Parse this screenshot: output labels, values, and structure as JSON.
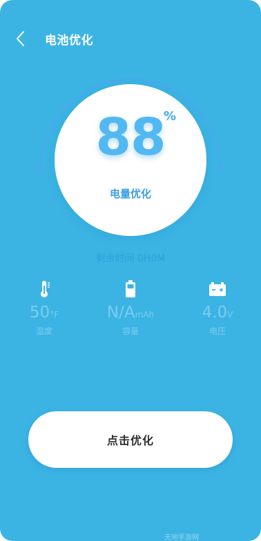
{
  "header": {
    "title": "电池优化"
  },
  "battery": {
    "percent": "88",
    "unit": "%",
    "label": "电量优化",
    "level": 0.88
  },
  "remaining": {
    "text": "剩余时间 0H0M"
  },
  "stats": [
    {
      "value": "50",
      "unit": "°F",
      "label": "温度",
      "icon": "thermometer-icon"
    },
    {
      "value": "N/A",
      "unit": "mAh",
      "label": "容量",
      "icon": "battery-icon"
    },
    {
      "value": "4.0",
      "unit": "V",
      "label": "电压",
      "icon": "voltage-icon"
    }
  ],
  "action": {
    "button_label": "点击优化"
  },
  "watermark": {
    "text": "天地手游网"
  },
  "colors": {
    "background": "#3bb4e4",
    "accent": "#52b8f2",
    "gauge_arc": "#4aa9ec",
    "stat_text": "#7cccee",
    "button": "#ffffff"
  }
}
